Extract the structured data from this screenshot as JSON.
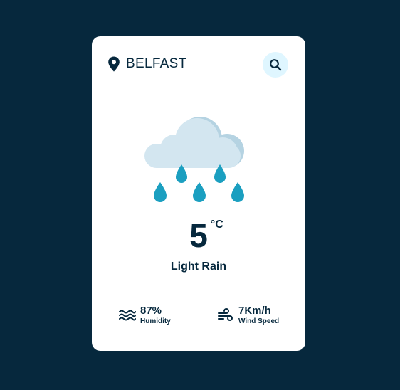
{
  "location": {
    "icon": "map-pin-icon",
    "city": "BELFAST"
  },
  "search": {
    "icon": "search-icon",
    "bg_color": "#dff6ff"
  },
  "weather": {
    "icon": "cloud-rain-icon",
    "temperature": "5",
    "unit": "°C",
    "description": "Light Rain"
  },
  "details": {
    "humidity": {
      "icon": "waves-icon",
      "value": "87%",
      "label": "Humidity"
    },
    "wind": {
      "icon": "wind-icon",
      "value": "7Km/h",
      "label": "Wind Speed"
    }
  },
  "colors": {
    "background": "#06283d",
    "card": "#ffffff",
    "text": "#06283d",
    "cloud": "#d3e6f0",
    "raindrop": "#1b9fc0"
  }
}
